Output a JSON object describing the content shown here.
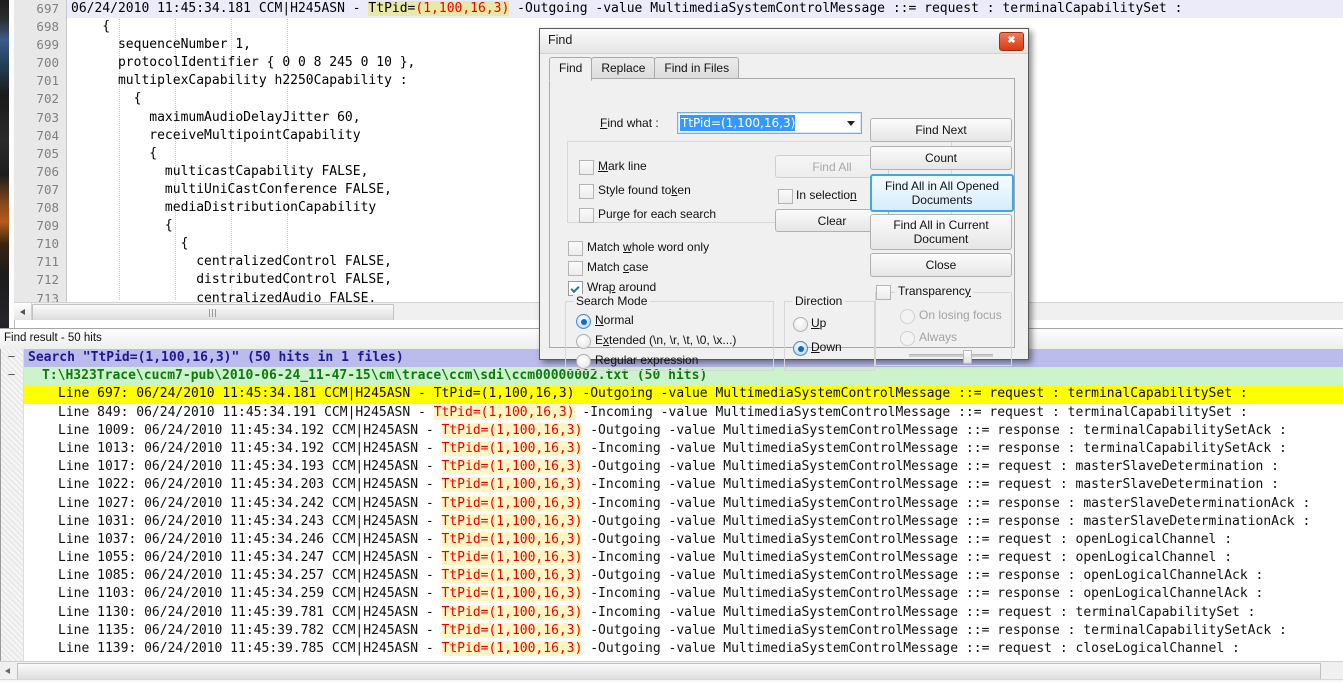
{
  "editor": {
    "current_line_number": "697",
    "lines": [
      {
        "num": "697",
        "pre": "06/24/2010 11:45:34.181 CCM|H245ASN - ",
        "hit_prefix": "TtPid=",
        "hit_val": "(1,100,16,3)",
        "post": " -Outgoing -value MultimediaSystemControlMessage ::= request : terminalCapabilitySet :",
        "current": true
      },
      {
        "num": "698",
        "text": "    {"
      },
      {
        "num": "699",
        "text": "      sequenceNumber 1,"
      },
      {
        "num": "700",
        "text": "      protocolIdentifier { 0 0 8 245 0 10 },"
      },
      {
        "num": "701",
        "text": "      multiplexCapability h2250Capability :"
      },
      {
        "num": "702",
        "text": "        {"
      },
      {
        "num": "703",
        "text": "          maximumAudioDelayJitter 60,"
      },
      {
        "num": "704",
        "text": "          receiveMultipointCapability"
      },
      {
        "num": "705",
        "text": "          {"
      },
      {
        "num": "706",
        "text": "            multicastCapability FALSE,"
      },
      {
        "num": "707",
        "text": "            multiUniCastConference FALSE,"
      },
      {
        "num": "708",
        "text": "            mediaDistributionCapability"
      },
      {
        "num": "709",
        "text": "            {"
      },
      {
        "num": "710",
        "text": "              {"
      },
      {
        "num": "711",
        "text": "                centralizedControl FALSE,"
      },
      {
        "num": "712",
        "text": "                distributedControl FALSE,"
      },
      {
        "num": "713",
        "text": "                centralizedAudio FALSE,"
      }
    ]
  },
  "find_result_panel": {
    "title": "Find result - 50 hits",
    "search_header": "Search \"TtPid=(1,100,16,3)\" (50 hits in 1 files)",
    "file_header": "T:\\H323Trace\\cucm7-pub\\2010-06-24_11-47-15\\cm\\trace\\ccm\\sdi\\ccm00000002.txt (50 hits)",
    "fold_marker": "−",
    "token": "TtPid=(1,100,16,3)",
    "rows": [
      {
        "line": "Line 697:",
        "ts": "06/24/2010 11:45:34.181 CCM|H245ASN - ",
        "tok": "TtPid=(1,100,16,3)",
        "rest": " -Outgoing -value MultimediaSystemControlMessage ::= request : terminalCapabilitySet :",
        "selected": true
      },
      {
        "line": "Line 849:",
        "ts": "06/24/2010 11:45:34.191 CCM|H245ASN - ",
        "tok": "TtPid=(1,100,16,3)",
        "rest": " -Incoming -value MultimediaSystemControlMessage ::= request : terminalCapabilitySet :",
        "selected": false
      },
      {
        "line": "Line 1009:",
        "ts": "06/24/2010 11:45:34.192 CCM|H245ASN - ",
        "tok": "TtPid=(1,100,16,3)",
        "rest": " -Outgoing -value MultimediaSystemControlMessage ::= response : terminalCapabilitySetAck :",
        "selected": false
      },
      {
        "line": "Line 1013:",
        "ts": "06/24/2010 11:45:34.192 CCM|H245ASN - ",
        "tok": "TtPid=(1,100,16,3)",
        "rest": " -Incoming -value MultimediaSystemControlMessage ::= response : terminalCapabilitySetAck :",
        "selected": false
      },
      {
        "line": "Line 1017:",
        "ts": "06/24/2010 11:45:34.193 CCM|H245ASN - ",
        "tok": "TtPid=(1,100,16,3)",
        "rest": " -Outgoing -value MultimediaSystemControlMessage ::= request : masterSlaveDetermination :",
        "selected": false
      },
      {
        "line": "Line 1022:",
        "ts": "06/24/2010 11:45:34.203 CCM|H245ASN - ",
        "tok": "TtPid=(1,100,16,3)",
        "rest": " -Incoming -value MultimediaSystemControlMessage ::= request : masterSlaveDetermination :",
        "selected": false
      },
      {
        "line": "Line 1027:",
        "ts": "06/24/2010 11:45:34.242 CCM|H245ASN - ",
        "tok": "TtPid=(1,100,16,3)",
        "rest": " -Incoming -value MultimediaSystemControlMessage ::= response : masterSlaveDeterminationAck :",
        "selected": false
      },
      {
        "line": "Line 1031:",
        "ts": "06/24/2010 11:45:34.243 CCM|H245ASN - ",
        "tok": "TtPid=(1,100,16,3)",
        "rest": " -Outgoing -value MultimediaSystemControlMessage ::= response : masterSlaveDeterminationAck :",
        "selected": false
      },
      {
        "line": "Line 1037:",
        "ts": "06/24/2010 11:45:34.246 CCM|H245ASN - ",
        "tok": "TtPid=(1,100,16,3)",
        "rest": " -Outgoing -value MultimediaSystemControlMessage ::= request : openLogicalChannel :",
        "selected": false
      },
      {
        "line": "Line 1055:",
        "ts": "06/24/2010 11:45:34.247 CCM|H245ASN - ",
        "tok": "TtPid=(1,100,16,3)",
        "rest": " -Incoming -value MultimediaSystemControlMessage ::= request : openLogicalChannel :",
        "selected": false
      },
      {
        "line": "Line 1085:",
        "ts": "06/24/2010 11:45:34.257 CCM|H245ASN - ",
        "tok": "TtPid=(1,100,16,3)",
        "rest": " -Outgoing -value MultimediaSystemControlMessage ::= response : openLogicalChannelAck :",
        "selected": false
      },
      {
        "line": "Line 1103:",
        "ts": "06/24/2010 11:45:34.259 CCM|H245ASN - ",
        "tok": "TtPid=(1,100,16,3)",
        "rest": " -Incoming -value MultimediaSystemControlMessage ::= response : openLogicalChannelAck :",
        "selected": false
      },
      {
        "line": "Line 1130:",
        "ts": "06/24/2010 11:45:39.781 CCM|H245ASN - ",
        "tok": "TtPid=(1,100,16,3)",
        "rest": " -Incoming -value MultimediaSystemControlMessage ::= request : terminalCapabilitySet :",
        "selected": false
      },
      {
        "line": "Line 1135:",
        "ts": "06/24/2010 11:45:39.782 CCM|H245ASN - ",
        "tok": "TtPid=(1,100,16,3)",
        "rest": " -Outgoing -value MultimediaSystemControlMessage ::= response : terminalCapabilitySetAck :",
        "selected": false
      },
      {
        "line": "Line 1139:",
        "ts": "06/24/2010 11:45:39.785 CCM|H245ASN - ",
        "tok": "TtPid=(1,100,16,3)",
        "rest": " -Outgoing -value MultimediaSystemControlMessage ::= request : closeLogicalChannel :",
        "selected": false
      }
    ]
  },
  "find_dialog": {
    "title": "Find",
    "close_label": "✖",
    "tabs": [
      {
        "label": "Find",
        "active": true
      },
      {
        "label": "Replace",
        "active": false
      },
      {
        "label": "Find in Files",
        "active": false
      }
    ],
    "find_what_label": "Find what :",
    "find_what_value": "TtPid=(1,100,16,3)",
    "checkboxes": [
      {
        "label": "Mark line",
        "checked": false
      },
      {
        "label": "Style found token",
        "checked": false
      },
      {
        "label": "Purge for each search",
        "checked": false
      },
      {
        "label": "In selection",
        "checked": false
      },
      {
        "label": "Match whole word only",
        "checked": false
      },
      {
        "label": "Match case",
        "checked": false
      },
      {
        "label": "Wrap around",
        "checked": true
      }
    ],
    "buttons": {
      "find_all": "Find All",
      "clear": "Clear",
      "find_next": "Find Next",
      "count": "Count",
      "find_all_opened": "Find All in All Opened Documents",
      "find_all_current": "Find All in Current Document",
      "close": "Close"
    },
    "search_mode": {
      "caption": "Search Mode",
      "options": [
        {
          "label": "Normal",
          "selected": true
        },
        {
          "label": "Extended (\\n, \\r, \\t, \\0, \\x...)",
          "selected": false
        },
        {
          "label": "Regular expression",
          "selected": false
        }
      ]
    },
    "direction": {
      "caption": "Direction",
      "options": [
        {
          "label": "Up",
          "selected": false
        },
        {
          "label": "Down",
          "selected": true
        }
      ]
    },
    "transparency": {
      "caption": "Transparency",
      "checked": false,
      "options": [
        {
          "label": "On losing focus",
          "selected": false,
          "disabled": true
        },
        {
          "label": "Always",
          "selected": false,
          "disabled": true
        }
      ]
    }
  },
  "colors": {
    "selection_yellow": "#ffff00",
    "token_red": "#ee0000",
    "search_header_bg": "#bcbcec",
    "file_header_bg": "#ccf3cc",
    "focus_blue": "#3ba9e8",
    "close_red": "#d63b17"
  }
}
